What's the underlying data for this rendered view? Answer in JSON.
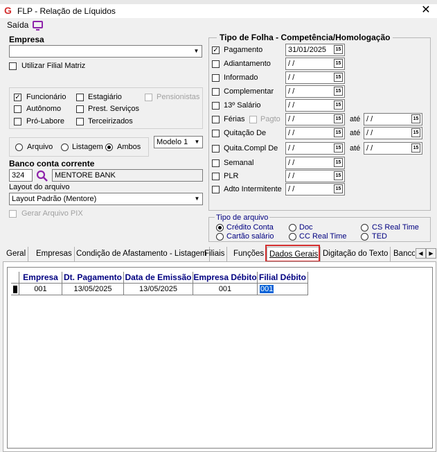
{
  "window": {
    "title": "FLP - Relação de Líquidos"
  },
  "menu": {
    "saida": "Saída"
  },
  "empresa": {
    "label": "Empresa",
    "value": "",
    "utilizar_filial": "Utilizar Filial Matriz"
  },
  "tipos_func": {
    "funcionario": "Funcionário",
    "estagiario": "Estagiário",
    "pensionistas": "Pensionistas",
    "autonomo": "Autônomo",
    "prest_servicos": "Prest. Serviços",
    "pro_labore": "Pró-Labore",
    "terceirizados": "Terceirizados"
  },
  "saida_opts": {
    "arquivo": "Arquivo",
    "listagem": "Listagem",
    "ambos": "Ambos",
    "modelo": "Modelo 1"
  },
  "banco": {
    "label": "Banco conta corrente",
    "code": "324",
    "name": "MENTORE BANK"
  },
  "layout": {
    "label": "Layout do arquivo",
    "value": "Layout Padrão (Mentore)",
    "gerar_pix": "Gerar Arquivo PIX"
  },
  "tipo_folha": {
    "header": "Tipo de Folha  -  Competência/Homologação",
    "ate": "até",
    "pagto": "Pagto",
    "items": [
      {
        "label": "Pagamento",
        "date": "31/01/2025"
      },
      {
        "label": "Adiantamento",
        "date": " /  /"
      },
      {
        "label": "Informado",
        "date": " /  /"
      },
      {
        "label": "Complementar",
        "date": " /  /"
      },
      {
        "label": "13º Salário",
        "date": " /  /"
      },
      {
        "label": "Férias",
        "date": " /  /",
        "date2": " /  /"
      },
      {
        "label": "Quitação De",
        "date": " /  /",
        "date2": " /  /"
      },
      {
        "label": "Quita.Compl De",
        "date": " /  /",
        "date2": " /  /"
      },
      {
        "label": "Semanal",
        "date": " /  /"
      },
      {
        "label": "PLR",
        "date": " /  /"
      },
      {
        "label": "Adto Intermitente",
        "date": " /  /"
      }
    ]
  },
  "tipo_arquivo": {
    "label": "Tipo de arquivo",
    "credito_conta": "Crédito Conta",
    "doc": "Doc",
    "cs_real_time": "CS Real Time",
    "cartao_salario": "Cartão salário",
    "cc_real_time": "CC Real Time",
    "ted": "TED"
  },
  "tabs": [
    "Geral",
    "Empresas",
    "Condição de Afastamento - Listagem",
    "Filiais",
    "Funções",
    "Dados Gerais",
    "Digitação do Texto",
    "Banco"
  ],
  "grid": {
    "headers": [
      "Empresa",
      "Dt. Pagamento",
      "Data de Emissão",
      "Empresa Débito",
      "Filial Débito"
    ],
    "row": [
      "001",
      "13/05/2025",
      "13/05/2025",
      "001",
      "001"
    ]
  },
  "colors": {
    "grid_header": "#000080",
    "highlight": "#d32f2f",
    "selection": "#0a64d8"
  }
}
